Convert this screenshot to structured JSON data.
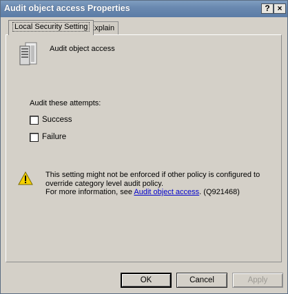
{
  "window": {
    "title": "Audit object access Properties",
    "help_button": "?",
    "close_button": "×"
  },
  "tabs": [
    {
      "label": "Local Security Setting",
      "active": true
    },
    {
      "label": "Explain",
      "active": false
    }
  ],
  "policy": {
    "icon": "server-icon",
    "name": "Audit object access"
  },
  "audit": {
    "label": "Audit these attempts:",
    "options": [
      {
        "label": "Success",
        "checked": false
      },
      {
        "label": "Failure",
        "checked": false
      }
    ]
  },
  "warning": {
    "icon": "warning-icon",
    "line1": "This setting might not be enforced if other policy is configured to",
    "line2": "override category level audit policy.",
    "line3_prefix": "For more information, see ",
    "link_text": "Audit object access",
    "line3_suffix": ". (Q921468)"
  },
  "buttons": {
    "ok": "OK",
    "cancel": "Cancel",
    "apply": "Apply",
    "apply_enabled": false
  }
}
